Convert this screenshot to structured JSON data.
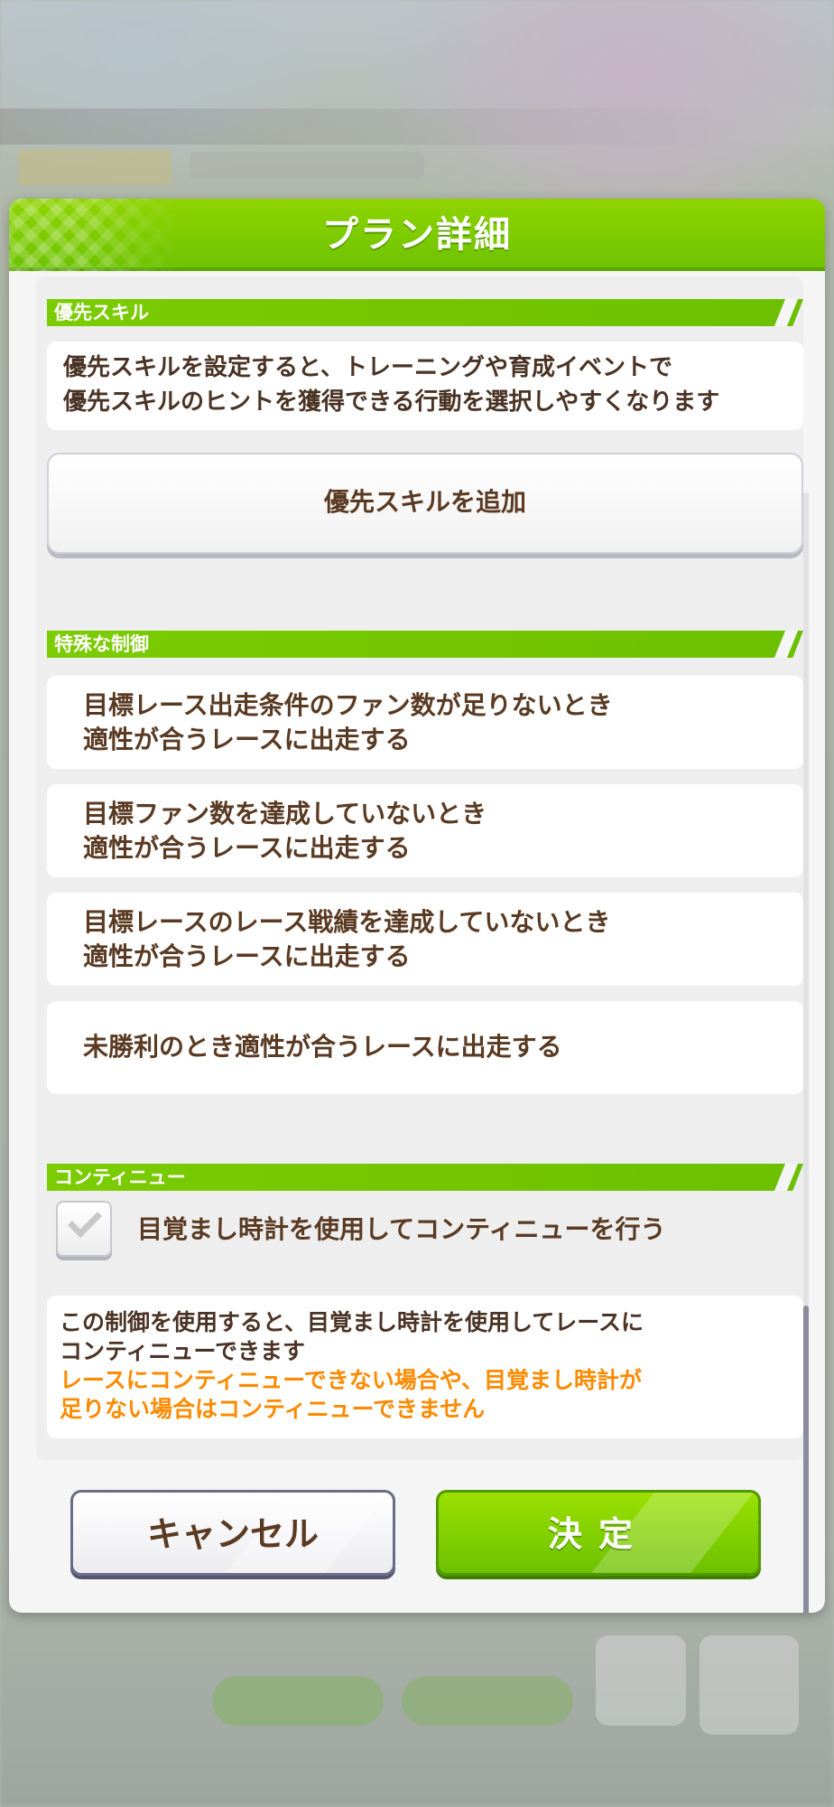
{
  "dialog": {
    "title": "プラン詳細",
    "accent_color": "#7bcc00"
  },
  "priority_skill": {
    "section_title": "優先スキル",
    "description_line1": "優先スキルを設定すると、トレーニングや育成イベントで",
    "description_line2": "優先スキルのヒントを獲得できる行動を選択しやすくなります",
    "add_button_label": "優先スキルを追加"
  },
  "special_control": {
    "section_title": "特殊な制御",
    "options": [
      {
        "line1": "目標レース出走条件のファン数が足りないとき",
        "line2": "適性が合うレースに出走する"
      },
      {
        "line1": "目標ファン数を達成していないとき",
        "line2": "適性が合うレースに出走する"
      },
      {
        "line1": "目標レースのレース戦績を達成していないとき",
        "line2": "適性が合うレースに出走する"
      },
      {
        "line1": "未勝利のとき適性が合うレースに出走する",
        "line2": ""
      }
    ]
  },
  "continue": {
    "section_title": "コンティニュー",
    "checkbox_label": "目覚まし時計を使用してコンティニューを行う",
    "checkbox_checked": true,
    "notice_line1": "この制御を使用すると、目覚まし時計を使用してレースに",
    "notice_line2": "コンティニューできます",
    "warning_line1": "レースにコンティニューできない場合や、目覚まし時計が",
    "warning_line2": "足りない場合はコンティニューできません",
    "warning_color": "#ff8a00"
  },
  "buttons": {
    "cancel_label": "キャンセル",
    "confirm_label": "決定"
  }
}
